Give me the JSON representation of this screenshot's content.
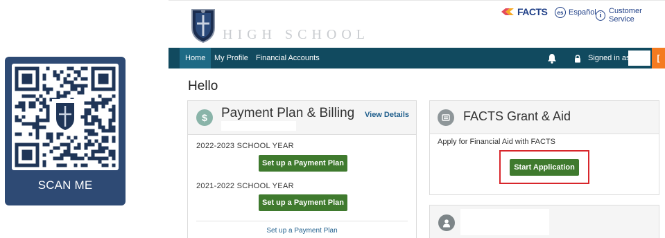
{
  "qr": {
    "label": "SCAN ME"
  },
  "header": {
    "school_name": "HIGH SCHOOL",
    "facts_logo": "FACTS",
    "language_badge": "es",
    "language_link": "Español",
    "help_badge": "i",
    "help_link": "Customer Service"
  },
  "nav": {
    "items": [
      {
        "label": "Home",
        "active": true
      },
      {
        "label": "My Profile",
        "active": false
      },
      {
        "label": "Financial Accounts",
        "active": false
      }
    ],
    "signed_in": "Signed in as",
    "logout_glyph": "[",
    "active_color": "#1e6a85",
    "bar_color": "#114a5f",
    "logout_color": "#f47b20"
  },
  "greeting": "Hello",
  "payment_panel": {
    "icon": "$",
    "title": "Payment Plan & Billing",
    "view_details": "View Details",
    "years": [
      {
        "label": "2022-2023 SCHOOL YEAR",
        "button": "Set up a Payment Plan"
      },
      {
        "label": "2021-2022 SCHOOL YEAR",
        "button": "Set up a Payment Plan"
      }
    ],
    "footer_link": "Set up a Payment Plan"
  },
  "grant_panel": {
    "title": "FACTS Grant & Aid",
    "description": "Apply for Financial Aid with FACTS",
    "button": "Start Application"
  },
  "colors": {
    "button_green": "#3f7a2e",
    "link_blue": "#1f5e8c",
    "highlight_red": "#d8262b",
    "qr_card": "#2e4a74"
  }
}
